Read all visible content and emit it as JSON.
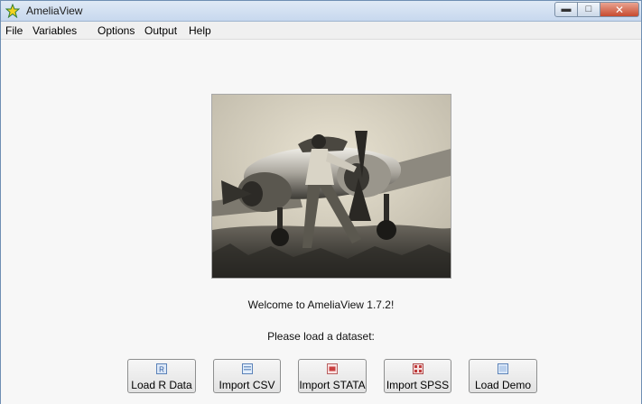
{
  "window": {
    "title": "AmeliaView"
  },
  "menu": [
    {
      "label": "File"
    },
    {
      "label": "Variables"
    },
    {
      "label": "Options"
    },
    {
      "label": "Output"
    },
    {
      "label": "Help"
    }
  ],
  "main": {
    "welcome_text": "Welcome to AmeliaView 1.7.2!",
    "prompt_text": "Please load a dataset:",
    "photo": "black-and-white photo of aviator beside airplane"
  },
  "buttons": [
    {
      "label": "Load R Data",
      "icon": "r-data-icon"
    },
    {
      "label": "Import CSV",
      "icon": "csv-file-icon"
    },
    {
      "label": "Import STATA",
      "icon": "stata-file-icon"
    },
    {
      "label": "Import SPSS",
      "icon": "spss-file-icon"
    },
    {
      "label": "Load Demo",
      "icon": "demo-file-icon"
    }
  ],
  "colors": {
    "title_bar": "#c7d8ee",
    "close_button": "#c74a2f",
    "background": "#f7f7f7"
  }
}
